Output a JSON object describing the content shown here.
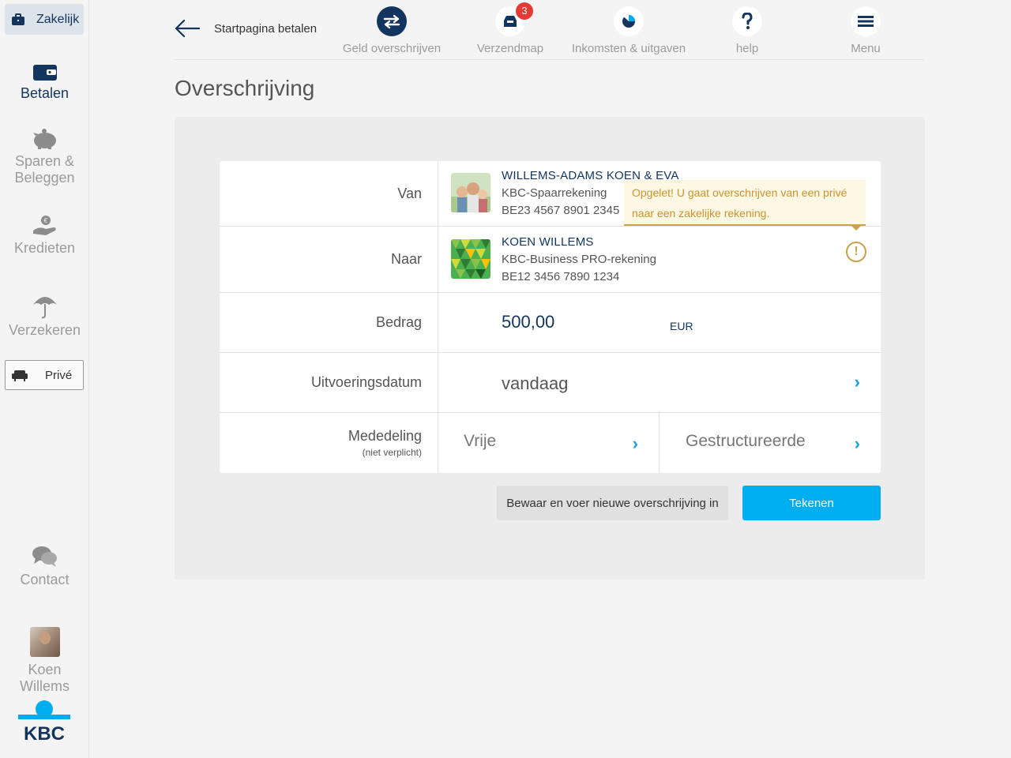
{
  "sidebar": {
    "zakelijk_label": "Zakelijk",
    "items": [
      {
        "label": "Betalen"
      },
      {
        "label": "Sparen &"
      },
      {
        "label": "Beleggen"
      },
      {
        "label": "Kredieten"
      },
      {
        "label": "Verzekeren"
      }
    ],
    "prive_label": "Privé",
    "contact_label": "Contact",
    "user_first": "Koen",
    "user_last": "Willems",
    "brand": "KBC"
  },
  "topnav": {
    "back_label": "Startpagina betalen",
    "items": [
      {
        "label": "Geld overschrijven"
      },
      {
        "label": "Verzendmap",
        "badge": "3"
      },
      {
        "label": "Inkomsten & uitgaven"
      },
      {
        "label": "help"
      },
      {
        "label": "Menu"
      }
    ]
  },
  "page": {
    "title": "Overschrijving"
  },
  "form": {
    "van": {
      "label": "Van",
      "name": "WILLEMS-ADAMS KOEN & EVA",
      "type": "KBC-Spaarrekening",
      "iban": "BE23 4567 8901 2345"
    },
    "warning": "Opgelet! U gaat overschrijven van een privé naar een zakelijke rekening.",
    "naar": {
      "label": "Naar",
      "name": "KOEN WILLEMS",
      "type": "KBC-Business PRO-rekening",
      "iban": "BE12 3456 7890 1234"
    },
    "bedrag": {
      "label": "Bedrag",
      "value": "500,00",
      "currency": "EUR"
    },
    "uitvoeringsdatum": {
      "label": "Uitvoeringsdatum",
      "value": "vandaag"
    },
    "mededeling": {
      "label": "Mededeling",
      "sublabel": "(niet verplicht)",
      "option_free": "Vrije",
      "option_structured": "Gestructureerde"
    }
  },
  "actions": {
    "save_label": "Bewaar en voer nieuwe overschrijving in",
    "sign_label": "Tekenen"
  },
  "colors": {
    "navy": "#12345e",
    "accent": "#00aeef",
    "warning": "#c9a24b"
  }
}
